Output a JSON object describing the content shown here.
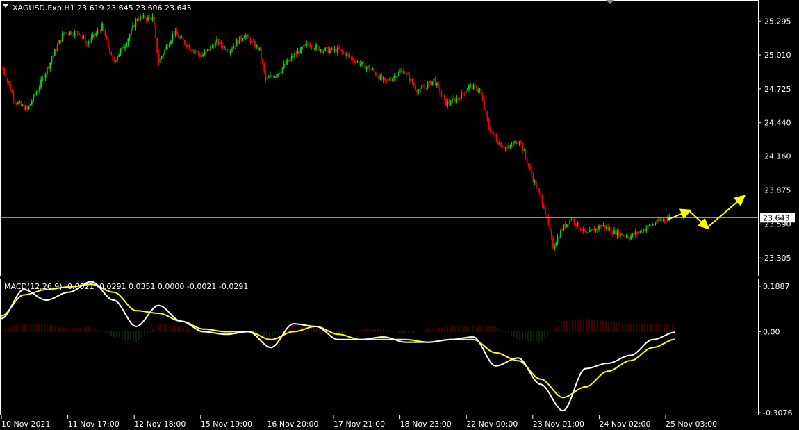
{
  "header": {
    "symbol_line": "XAGUSD.Exp,H1  23.619 23.645 23.606 23.643",
    "macd_line": "MACD(12,26,9) -0.0021 -0.0291 0.0351 0.0000 -0.0021 -0.0291"
  },
  "current_price_label": "23.643",
  "colors": {
    "background": "#000000",
    "bull": "#00e000",
    "bear": "#ff0000",
    "macd_line": "#ffffff",
    "signal_line": "#ffff00",
    "arrows": "#ffff00",
    "axis": "#ffffff"
  },
  "chart_data": [
    {
      "type": "candlestick",
      "title": "XAGUSD.Exp,H1",
      "ohlc_last": {
        "open": 23.619,
        "high": 23.645,
        "low": 23.606,
        "close": 23.643
      },
      "ylim": [
        23.16,
        25.46
      ],
      "y_ticks": [
        "25.295",
        "25.010",
        "24.725",
        "24.440",
        "24.160",
        "23.875",
        "23.590",
        "23.305"
      ],
      "current_price": 23.643,
      "x_tick_labels": [
        "10 Nov 2021",
        "11 Nov 17:00",
        "12 Nov 18:00",
        "15 Nov 19:00",
        "16 Nov 20:00",
        "17 Nov 21:00",
        "18 Nov 23:00",
        "22 Nov 00:00",
        "23 Nov 01:00",
        "24 Nov 02:00",
        "25 Nov 03:00"
      ],
      "close_path_anchors": [
        [
          0,
          24.9
        ],
        [
          8,
          24.62
        ],
        [
          16,
          24.55
        ],
        [
          24,
          24.75
        ],
        [
          32,
          24.98
        ],
        [
          40,
          25.2
        ],
        [
          50,
          25.2
        ],
        [
          55,
          25.1
        ],
        [
          65,
          25.25
        ],
        [
          72,
          24.95
        ],
        [
          80,
          25.1
        ],
        [
          88,
          25.32
        ],
        [
          98,
          25.32
        ],
        [
          102,
          24.95
        ],
        [
          112,
          25.2
        ],
        [
          120,
          25.1
        ],
        [
          130,
          25.0
        ],
        [
          140,
          25.12
        ],
        [
          148,
          25.05
        ],
        [
          158,
          25.18
        ],
        [
          168,
          25.05
        ],
        [
          172,
          24.8
        ],
        [
          180,
          24.86
        ],
        [
          190,
          25.0
        ],
        [
          200,
          25.1
        ],
        [
          210,
          25.05
        ],
        [
          220,
          25.05
        ],
        [
          232,
          24.95
        ],
        [
          240,
          24.9
        ],
        [
          250,
          24.78
        ],
        [
          262,
          24.88
        ],
        [
          272,
          24.7
        ],
        [
          282,
          24.8
        ],
        [
          290,
          24.6
        ],
        [
          298,
          24.65
        ],
        [
          305,
          24.75
        ],
        [
          312,
          24.72
        ],
        [
          318,
          24.4
        ],
        [
          324,
          24.28
        ],
        [
          330,
          24.22
        ],
        [
          338,
          24.3
        ],
        [
          346,
          24.0
        ],
        [
          354,
          23.74
        ],
        [
          360,
          23.4
        ],
        [
          366,
          23.55
        ],
        [
          372,
          23.64
        ],
        [
          382,
          23.5
        ],
        [
          392,
          23.58
        ],
        [
          400,
          23.52
        ],
        [
          410,
          23.48
        ],
        [
          420,
          23.55
        ],
        [
          430,
          23.62
        ],
        [
          436,
          23.643
        ]
      ],
      "forecast_arrows": [
        [
          23.63,
          23.7
        ],
        [
          23.7,
          23.56
        ],
        [
          23.56,
          23.82
        ]
      ]
    },
    {
      "type": "line",
      "title": "MACD(12,26,9)",
      "ylim": [
        -0.3076,
        0.1887
      ],
      "y_ticks": [
        "0.1887",
        "0.00",
        "-0.3076"
      ],
      "series": [
        {
          "name": "MACD",
          "values": [
            0.05,
            0.16,
            0.12,
            0.15,
            0.19,
            0.12,
            0.02,
            0.1,
            0.04,
            0.0,
            -0.01,
            0.0,
            -0.06,
            0.03,
            0.02,
            -0.03,
            -0.03,
            -0.02,
            -0.04,
            -0.04,
            -0.03,
            -0.02,
            -0.13,
            -0.1,
            -0.2,
            -0.3,
            -0.14,
            -0.12,
            -0.09,
            -0.03,
            -0.002
          ]
        },
        {
          "name": "Signal",
          "values": [
            0.06,
            0.14,
            0.16,
            0.17,
            0.18,
            0.15,
            0.08,
            0.07,
            0.04,
            0.01,
            0.0,
            0.0,
            -0.03,
            0.0,
            0.02,
            -0.01,
            -0.03,
            -0.03,
            -0.03,
            -0.04,
            -0.03,
            -0.03,
            -0.08,
            -0.11,
            -0.18,
            -0.25,
            -0.21,
            -0.15,
            -0.11,
            -0.06,
            -0.029
          ]
        },
        {
          "name": "Histogram",
          "values": [
            0.01,
            0.03,
            0.03,
            0.01,
            0.02,
            -0.02,
            -0.04,
            0.03,
            0.02,
            -0.01,
            -0.01,
            0.0,
            -0.02,
            0.03,
            0.02,
            -0.01,
            0.01,
            0.01,
            -0.01,
            0.01,
            0.02,
            0.02,
            0.02,
            -0.03,
            -0.04,
            0.04,
            0.05,
            0.04,
            0.03,
            0.03,
            0.03
          ]
        }
      ]
    }
  ]
}
